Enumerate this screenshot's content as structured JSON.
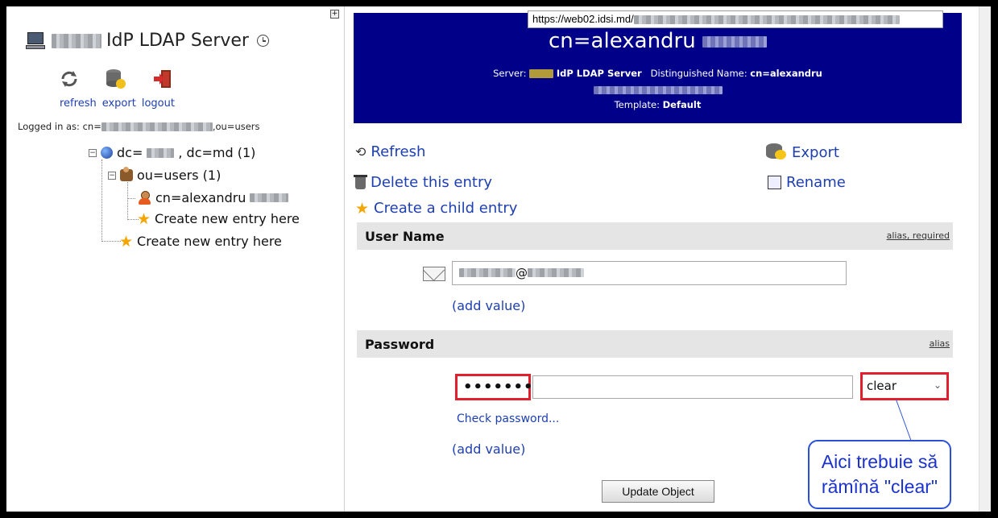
{
  "left": {
    "server_title": "IdP LDAP Server",
    "tools": {
      "refresh": "refresh",
      "export": "export",
      "logout": "logout"
    },
    "logged_in_prefix": "Logged in as: cn=",
    "logged_in_suffix": ",ou=users",
    "tree": {
      "root_prefix": "dc=",
      "root_suffix": ", dc=md (1)",
      "ou": "ou=users (1)",
      "user": "cn=alexandru",
      "create_child": "Create new entry here",
      "create_root": "Create new entry here"
    }
  },
  "tooltip": {
    "url": "https://web02.idsi.md/"
  },
  "header": {
    "title": "cn=alexandru",
    "server_label": "Server:",
    "server_name": "IdP LDAP Server",
    "dn_label": "Distinguished Name:",
    "dn_value": "cn=alexandru",
    "template_label": "Template:",
    "template_value": "Default"
  },
  "actions": {
    "refresh": "Refresh",
    "delete": "Delete this entry",
    "child": "Create a child entry",
    "export": "Export",
    "rename": "Rename"
  },
  "username_section": {
    "title": "User Name",
    "tags": "alias, required",
    "value_visible": "@",
    "add_value": "(add value)"
  },
  "password_section": {
    "title": "Password",
    "tags": "alias",
    "value": "•••••••",
    "hash_option": "clear",
    "check": "Check password...",
    "add_value": "(add value)"
  },
  "callout": {
    "line1": "Aici trebuie să",
    "line2": "rămînă \"clear\""
  },
  "update_button": "Update Object",
  "colors": {
    "header_bg": "#000088",
    "link": "#1d3fb0",
    "highlight": "#e0202e",
    "callout": "#1b33cc"
  }
}
